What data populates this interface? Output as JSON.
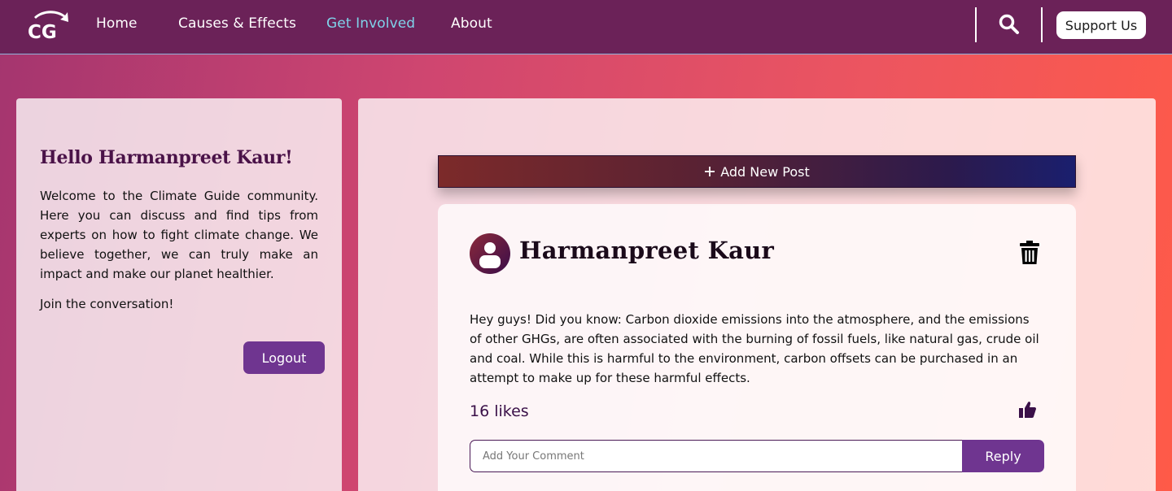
{
  "nav": {
    "logo_text": "CG",
    "links": [
      {
        "label": "Home",
        "active": false
      },
      {
        "label": "Causes & Effects",
        "active": false
      },
      {
        "label": "Get Involved",
        "active": true
      },
      {
        "label": "About",
        "active": false
      }
    ],
    "search_icon": "search-icon",
    "support_label": "Support Us"
  },
  "sidebar": {
    "greeting": "Hello Harmanpreet Kaur!",
    "welcome": "Welcome to the Climate Guide community. Here you can discuss and find tips from experts on how to fight climate change. We believe together, we can truly make an impact and make our planet healthier.",
    "join": "Join the conversation!",
    "logout_label": "Logout"
  },
  "main": {
    "add_post_label": "Add New Post",
    "post": {
      "author": "Harmanpreet Kaur",
      "body": "Hey guys! Did you know: Carbon dioxide emissions into the atmosphere, and the emissions of other GHGs, are often associated with the burning of fossil fuels, like natural gas, crude oil and coal. While this is harmful to the environment, carbon offsets can be purchased in an attempt to make up for these harmful effects.",
      "likes": "16 likes",
      "comment_placeholder": "Add Your Comment",
      "reply_label": "Reply"
    }
  },
  "colors": {
    "nav_bg": "#6b2258",
    "active_link": "#7fd3ea",
    "button_purple": "#6f3590",
    "heading_purple": "#4a1248"
  }
}
